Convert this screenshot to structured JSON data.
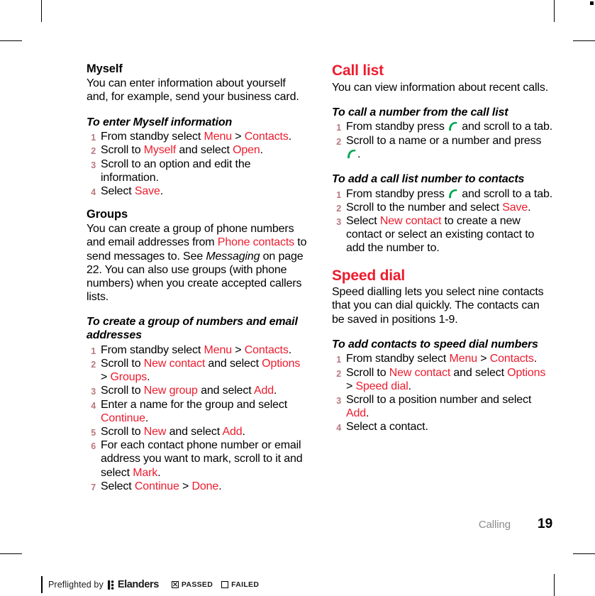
{
  "document": {
    "footer": {
      "chapter": "Calling",
      "page_number": "19"
    },
    "accent_color": "#ec1c2e",
    "call_key_color": "#00a651",
    "list_number_color": "#b9787f"
  },
  "left_column": {
    "myself": {
      "heading": "Myself",
      "body": "You can enter information about yourself and, for example, send your business card.",
      "procedure_title": "To enter Myself information",
      "steps": [
        {
          "num": "1",
          "parts": [
            {
              "t": "From standby select ",
              "s": "plain"
            },
            {
              "t": "Menu",
              "s": "hl"
            },
            {
              "t": " > ",
              "s": "plain"
            },
            {
              "t": "Contacts",
              "s": "hl"
            },
            {
              "t": ".",
              "s": "plain"
            }
          ]
        },
        {
          "num": "2",
          "parts": [
            {
              "t": "Scroll to ",
              "s": "plain"
            },
            {
              "t": "Myself",
              "s": "hl"
            },
            {
              "t": " and select ",
              "s": "plain"
            },
            {
              "t": "Open",
              "s": "hl"
            },
            {
              "t": ".",
              "s": "plain"
            }
          ]
        },
        {
          "num": "3",
          "parts": [
            {
              "t": "Scroll to an option and edit the information.",
              "s": "plain"
            }
          ]
        },
        {
          "num": "4",
          "parts": [
            {
              "t": "Select ",
              "s": "plain"
            },
            {
              "t": "Save",
              "s": "hl"
            },
            {
              "t": ".",
              "s": "plain"
            }
          ]
        }
      ]
    },
    "groups": {
      "heading": "Groups",
      "body_parts": [
        {
          "t": "You can create a group of phone numbers and email addresses from ",
          "s": "plain"
        },
        {
          "t": "Phone contacts",
          "s": "hl"
        },
        {
          "t": " to send messages to. See ",
          "s": "plain"
        },
        {
          "t": "Messaging",
          "s": "ital"
        },
        {
          "t": " on page 22. You can also use groups (with phone numbers) when you create accepted callers lists.",
          "s": "plain"
        }
      ],
      "procedure_title": "To create a group of numbers and email addresses",
      "steps": [
        {
          "num": "1",
          "parts": [
            {
              "t": "From standby select ",
              "s": "plain"
            },
            {
              "t": "Menu",
              "s": "hl"
            },
            {
              "t": " > ",
              "s": "plain"
            },
            {
              "t": "Contacts",
              "s": "hl"
            },
            {
              "t": ".",
              "s": "plain"
            }
          ]
        },
        {
          "num": "2",
          "parts": [
            {
              "t": "Scroll to ",
              "s": "plain"
            },
            {
              "t": "New contact",
              "s": "hl"
            },
            {
              "t": " and select ",
              "s": "plain"
            },
            {
              "t": "Options",
              "s": "hl"
            },
            {
              "t": " > ",
              "s": "plain"
            },
            {
              "t": "Groups",
              "s": "hl"
            },
            {
              "t": ".",
              "s": "plain"
            }
          ]
        },
        {
          "num": "3",
          "parts": [
            {
              "t": "Scroll to ",
              "s": "plain"
            },
            {
              "t": "New group",
              "s": "hl"
            },
            {
              "t": " and select ",
              "s": "plain"
            },
            {
              "t": "Add",
              "s": "hl"
            },
            {
              "t": ".",
              "s": "plain"
            }
          ]
        },
        {
          "num": "4",
          "parts": [
            {
              "t": "Enter a name for the group and select ",
              "s": "plain"
            },
            {
              "t": "Continue",
              "s": "hl"
            },
            {
              "t": ".",
              "s": "plain"
            }
          ]
        },
        {
          "num": "5",
          "parts": [
            {
              "t": "Scroll to ",
              "s": "plain"
            },
            {
              "t": "New",
              "s": "hl"
            },
            {
              "t": " and select ",
              "s": "plain"
            },
            {
              "t": "Add",
              "s": "hl"
            },
            {
              "t": ".",
              "s": "plain"
            }
          ]
        },
        {
          "num": "6",
          "parts": [
            {
              "t": "For each contact phone number or email address you want to mark, scroll to it and select ",
              "s": "plain"
            },
            {
              "t": "Mark",
              "s": "hl"
            },
            {
              "t": ".",
              "s": "plain"
            }
          ]
        },
        {
          "num": "7",
          "parts": [
            {
              "t": "Select ",
              "s": "plain"
            },
            {
              "t": "Continue",
              "s": "hl"
            },
            {
              "t": " > ",
              "s": "plain"
            },
            {
              "t": "Done",
              "s": "hl"
            },
            {
              "t": ".",
              "s": "plain"
            }
          ]
        }
      ]
    }
  },
  "right_column": {
    "call_list": {
      "heading": "Call list",
      "body": "You can view information about recent calls.",
      "procedure_1_title": "To call a number from the call list",
      "procedure_1_steps": [
        {
          "num": "1",
          "parts": [
            {
              "t": "From standby press ",
              "s": "plain"
            },
            {
              "t": "",
              "s": "callkey"
            },
            {
              "t": " and scroll to a tab.",
              "s": "plain"
            }
          ]
        },
        {
          "num": "2",
          "parts": [
            {
              "t": "Scroll to a name or a number and press ",
              "s": "plain"
            },
            {
              "t": "",
              "s": "callkey"
            },
            {
              "t": ".",
              "s": "plain"
            }
          ]
        }
      ],
      "procedure_2_title": "To add a call list number to contacts",
      "procedure_2_steps": [
        {
          "num": "1",
          "parts": [
            {
              "t": "From standby press ",
              "s": "plain"
            },
            {
              "t": "",
              "s": "callkey"
            },
            {
              "t": " and scroll to a tab.",
              "s": "plain"
            }
          ]
        },
        {
          "num": "2",
          "parts": [
            {
              "t": "Scroll to the number and select ",
              "s": "plain"
            },
            {
              "t": "Save",
              "s": "hl"
            },
            {
              "t": ".",
              "s": "plain"
            }
          ]
        },
        {
          "num": "3",
          "parts": [
            {
              "t": "Select ",
              "s": "plain"
            },
            {
              "t": "New contact",
              "s": "hl"
            },
            {
              "t": " to create a new contact or select an existing contact to add the number to.",
              "s": "plain"
            }
          ]
        }
      ]
    },
    "speed_dial": {
      "heading": "Speed dial",
      "body": "Speed dialling lets you select nine contacts that you can dial quickly. The contacts can be saved in positions 1-9.",
      "procedure_title": "To add contacts to speed dial numbers",
      "steps": [
        {
          "num": "1",
          "parts": [
            {
              "t": "From standby select ",
              "s": "plain"
            },
            {
              "t": "Menu",
              "s": "hl"
            },
            {
              "t": " > ",
              "s": "plain"
            },
            {
              "t": "Contacts",
              "s": "hl"
            },
            {
              "t": ".",
              "s": "plain"
            }
          ]
        },
        {
          "num": "2",
          "parts": [
            {
              "t": "Scroll to ",
              "s": "plain"
            },
            {
              "t": "New contact",
              "s": "hl"
            },
            {
              "t": " and select ",
              "s": "plain"
            },
            {
              "t": "Options",
              "s": "hl"
            },
            {
              "t": " > ",
              "s": "plain"
            },
            {
              "t": "Speed dial",
              "s": "hl"
            },
            {
              "t": ".",
              "s": "plain"
            }
          ]
        },
        {
          "num": "3",
          "parts": [
            {
              "t": "Scroll to a position number and select ",
              "s": "plain"
            },
            {
              "t": "Add",
              "s": "hl"
            },
            {
              "t": ".",
              "s": "plain"
            }
          ]
        },
        {
          "num": "4",
          "parts": [
            {
              "t": "Select a contact.",
              "s": "plain"
            }
          ]
        }
      ]
    }
  },
  "preflight": {
    "text": "Preflighted by",
    "logo_name": "Elanders",
    "passed_label": "PASSED",
    "failed_label": "FAILED",
    "passed_checked": true,
    "failed_checked": false
  }
}
